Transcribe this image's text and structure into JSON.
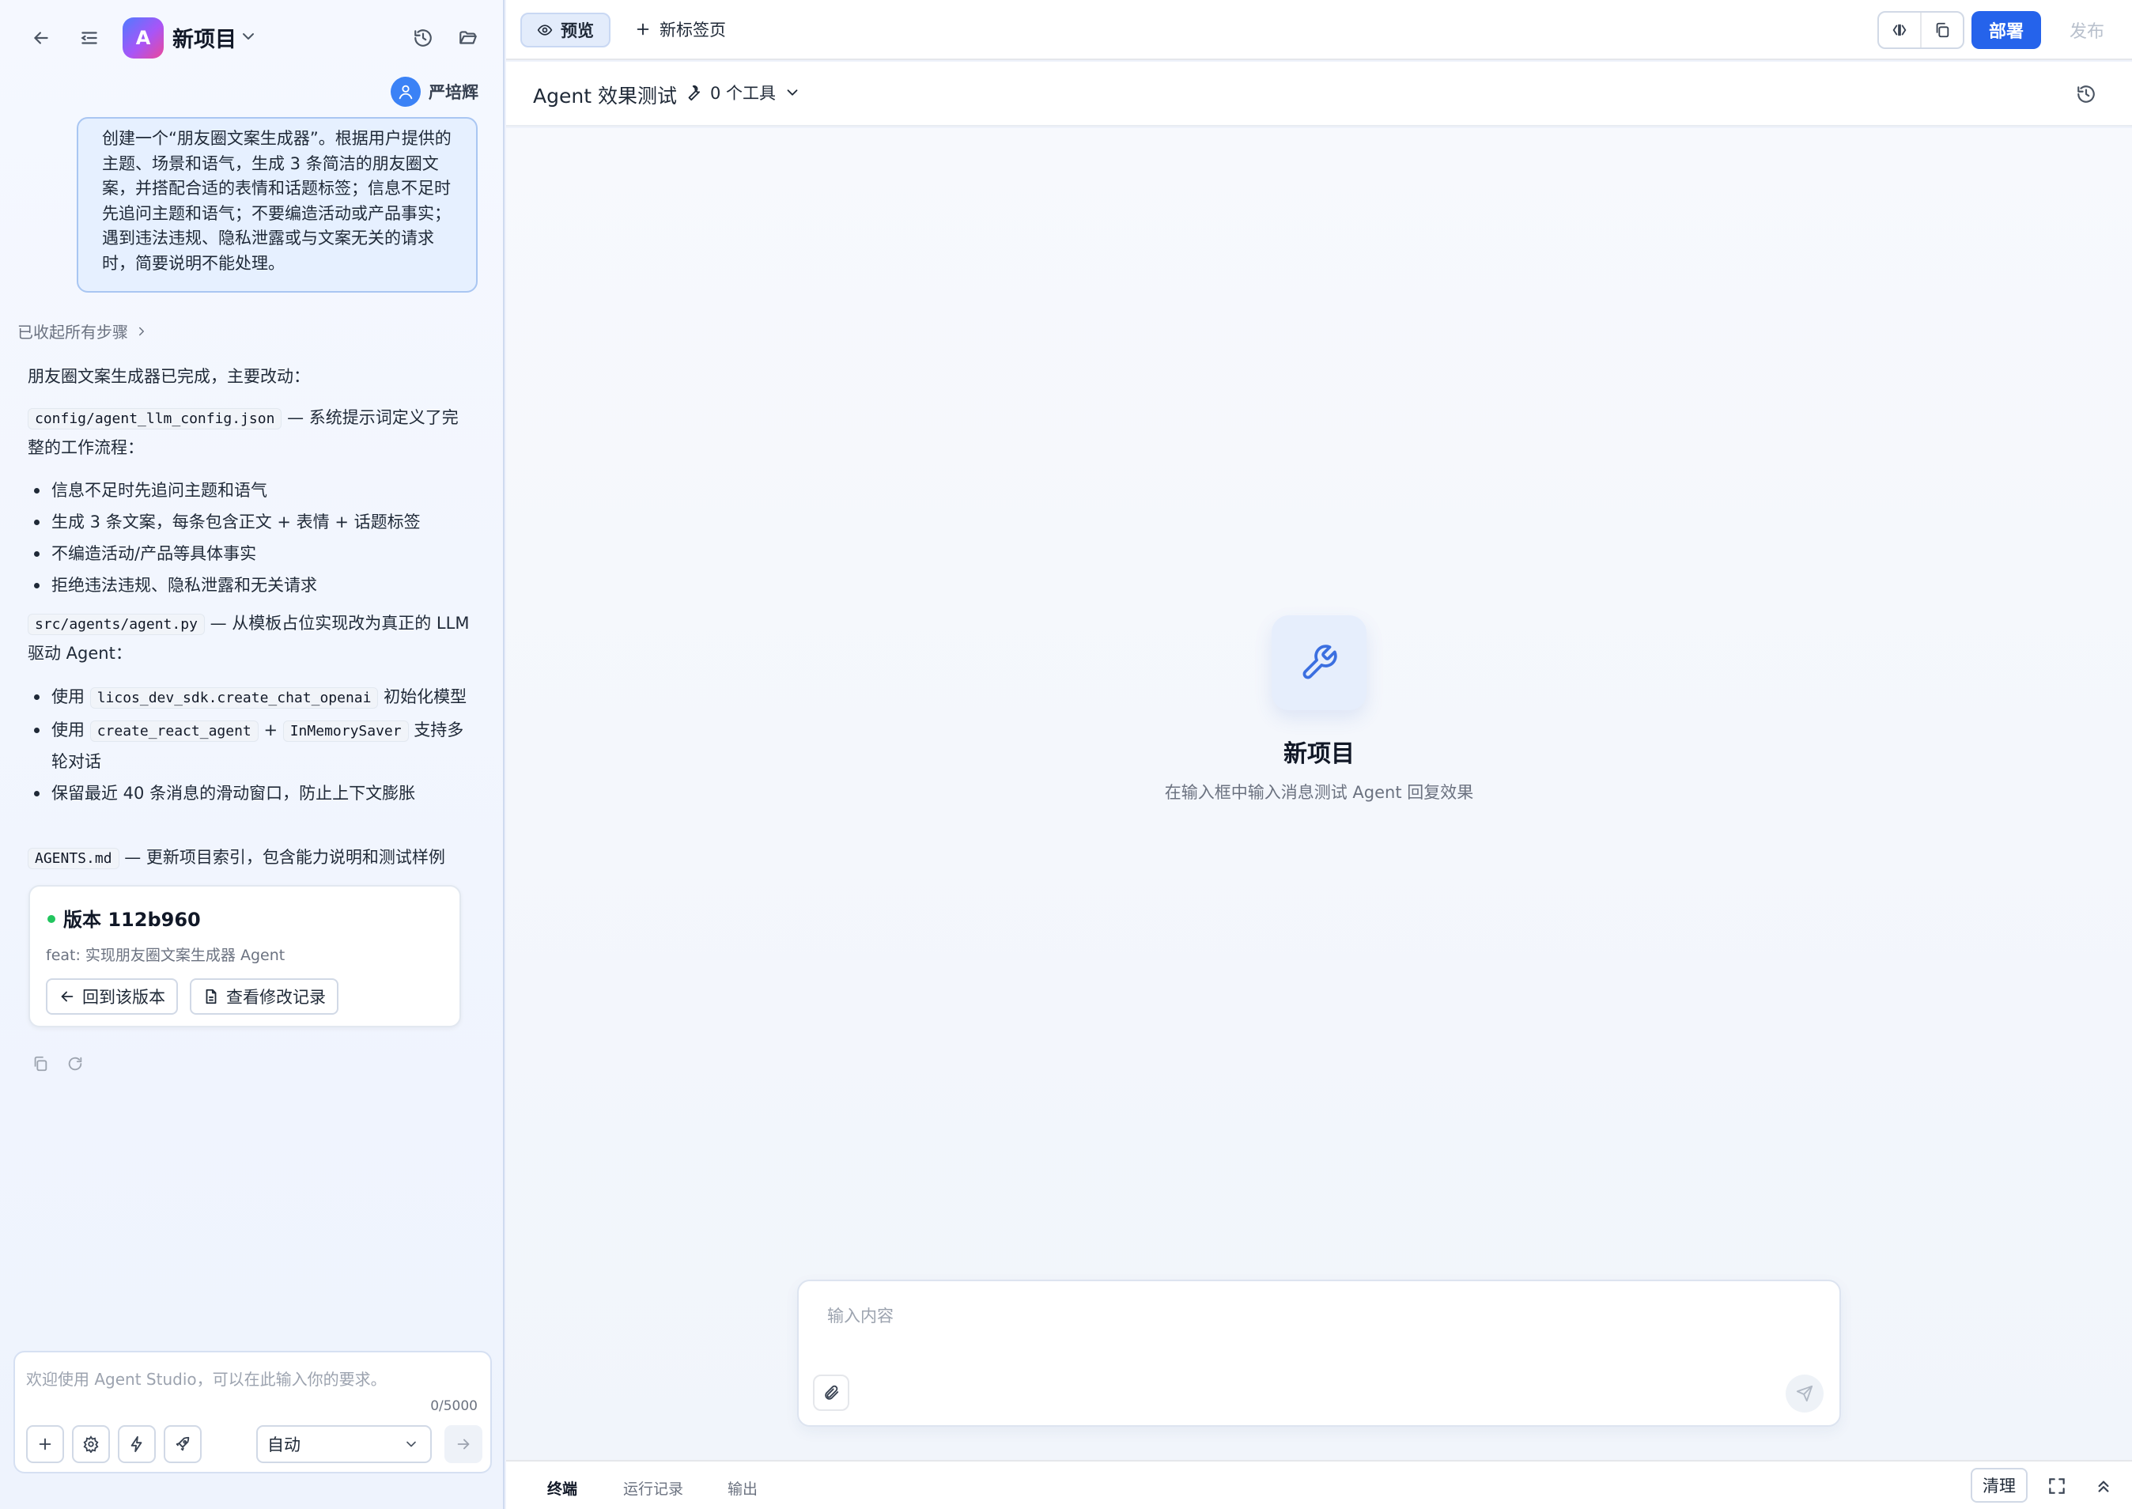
{
  "sidebar": {
    "project_initial": "A",
    "project_title": "新项目",
    "user_name": "严培辉",
    "user_message": "创建一个“朋友圈文案生成器”。根据用户提供的主题、场景和语气，生成 3 条简洁的朋友圈文案，并搭配合适的表情和话题标签；信息不足时先追问主题和语气；不要编造活动或产品事实；遇到违法违规、隐私泄露或与文案无关的请求时，简要说明不能处理。",
    "steps_toggle": "已收起所有步骤",
    "reply": {
      "intro": "朋友圈文案生成器已完成，主要改动：",
      "file1": "config/agent_llm_config.json",
      "file1_desc": " — 系统提示词定义了完整的工作流程：",
      "file1_points": [
        "信息不足时先追问主题和语气",
        "生成 3 条文案，每条包含正文 + 表情 + 话题标签",
        "不编造活动/产品等具体事实",
        "拒绝违法违规、隐私泄露和无关请求"
      ],
      "file2": "src/agents/agent.py",
      "file2_desc": " — 从模板占位实现改为真正的 LLM 驱动 Agent：",
      "file2_point1_pre": "使用 ",
      "file2_point1_code": "licos_dev_sdk.create_chat_openai",
      "file2_point1_post": " 初始化模型",
      "file2_point2_pre": "使用 ",
      "file2_point2_code1": "create_react_agent",
      "file2_point2_mid": " + ",
      "file2_point2_code2": "InMemorySaver",
      "file2_point2_post": " 支持多轮对话",
      "file2_point3": "保留最近 40 条消息的滑动窗口，防止上下文膨胀",
      "file3": "AGENTS.md",
      "file3_desc": " — 更新项目索引，包含能力说明和测试样例"
    },
    "version_card": {
      "title": "版本 112b960",
      "subtitle": "feat: 实现朋友圈文案生成器 Agent",
      "restore_label": "回到该版本",
      "changes_label": "查看修改记录"
    },
    "composer": {
      "placeholder": "欢迎使用 Agent Studio，可以在此输入你的要求。",
      "counter": "0/5000",
      "mode": "自动"
    }
  },
  "topbar": {
    "preview_tab": "预览",
    "new_tab": "新标签页",
    "deploy": "部署",
    "publish": "发布"
  },
  "subbar": {
    "title": "Agent 效果测试",
    "tools": "0 个工具"
  },
  "canvas": {
    "empty_title": "新项目",
    "empty_subtitle": "在输入框中输入消息测试 Agent 回复效果",
    "input_placeholder": "输入内容"
  },
  "bottombar": {
    "tabs": [
      "终端",
      "运行记录",
      "输出"
    ],
    "clear": "清理"
  },
  "colors": {
    "accent": "#2563eb",
    "user_bubble": "#e6f0ff",
    "version_dot": "#22c55e"
  }
}
